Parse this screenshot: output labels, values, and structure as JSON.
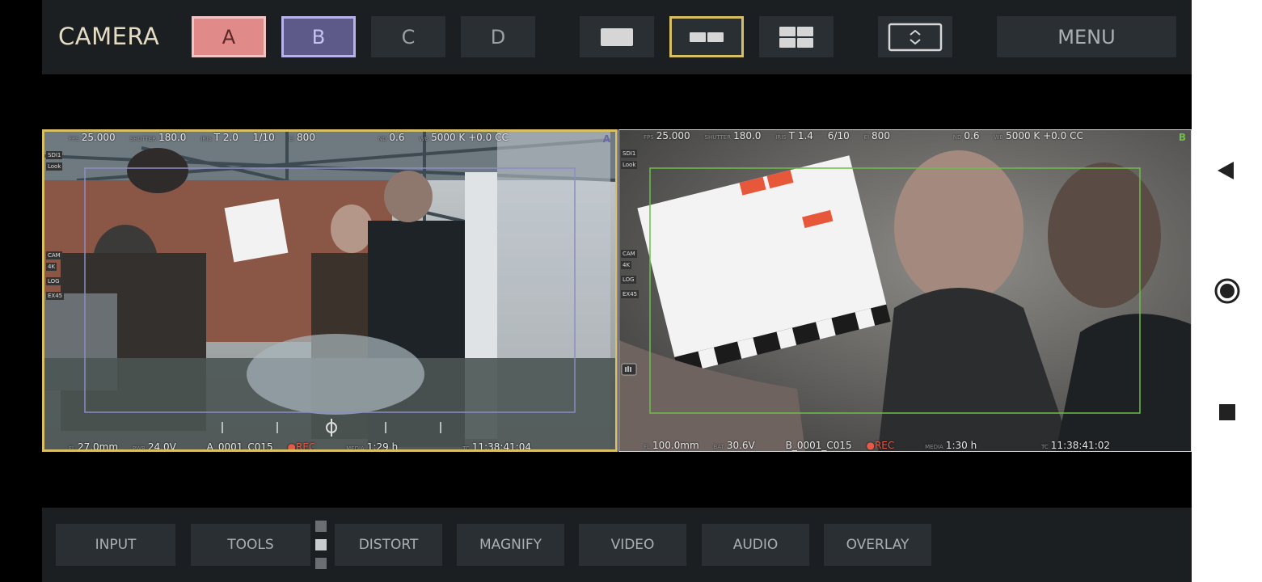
{
  "topbar": {
    "title": "CAMERA",
    "cam_buttons": [
      "A",
      "B",
      "C",
      "D"
    ],
    "menu_label": "MENU",
    "layout_icons": [
      "single-layout-icon",
      "dual-layout-icon",
      "quad-layout-icon",
      "fullscreen-toggle-icon"
    ]
  },
  "viewport_a": {
    "channel": "A",
    "top": {
      "fps_k": "FPS",
      "fps": "25.000",
      "shutter_k": "SHUTTER",
      "shutter": "180.0",
      "iris_k": "IRIS",
      "iris": "T 2.0",
      "iris2": "1/10",
      "ei_k": "EI",
      "ei": "800",
      "nd_k": "ND",
      "nd": "0.6",
      "wb_k": "WB",
      "wb": "5000 K +0.0 CC"
    },
    "left_tags": [
      "SDI1",
      "Look",
      "CAM",
      "4K",
      "LOG",
      "EX45"
    ],
    "bottom": {
      "fl_k": "FL",
      "fl": "27.0mm",
      "pwr_k": "PWR",
      "pwr": "24.0V",
      "clip": "A_0001_C015",
      "rec": "REC",
      "media_k": "MEDIA",
      "media": "1:29 h",
      "tc_k": "TC",
      "tc": "11:38:41:04"
    }
  },
  "viewport_b": {
    "channel": "B",
    "top": {
      "fps_k": "FPS",
      "fps": "25.000",
      "shutter_k": "SHUTTER",
      "shutter": "180.0",
      "iris_k": "IRIS",
      "iris": "T 1.4",
      "iris2": "6/10",
      "ei_k": "EI",
      "ei": "800",
      "nd_k": "ND",
      "nd": "0.6",
      "wb_k": "WB",
      "wb": "5000 K +0.0 CC"
    },
    "left_tags": [
      "SDI1",
      "Look",
      "CAM",
      "4K",
      "LOG",
      "EX45"
    ],
    "bottom": {
      "fl_k": "FL",
      "fl": "100.0mm",
      "bat_k": "BAT",
      "bat": "30.6V",
      "clip": "B_0001_C015",
      "rec": "REC",
      "media_k": "MEDIA",
      "media": "1:30 h",
      "tc_k": "TC",
      "tc": "11:38:41:02"
    }
  },
  "bottombar": {
    "tabs": [
      "INPUT",
      "TOOLS",
      "DISTORT",
      "MAGNIFY",
      "VIDEO",
      "AUDIO",
      "OVERLAY"
    ]
  },
  "navbar": {
    "icons": [
      "back-icon",
      "home-icon",
      "recents-icon"
    ]
  },
  "colors": {
    "cam_a": "#e08a8a",
    "cam_b": "#5d5a8a",
    "selected": "#d8bf63",
    "rec": "#e65a4a",
    "frameline_b": "#6fbe4a"
  }
}
